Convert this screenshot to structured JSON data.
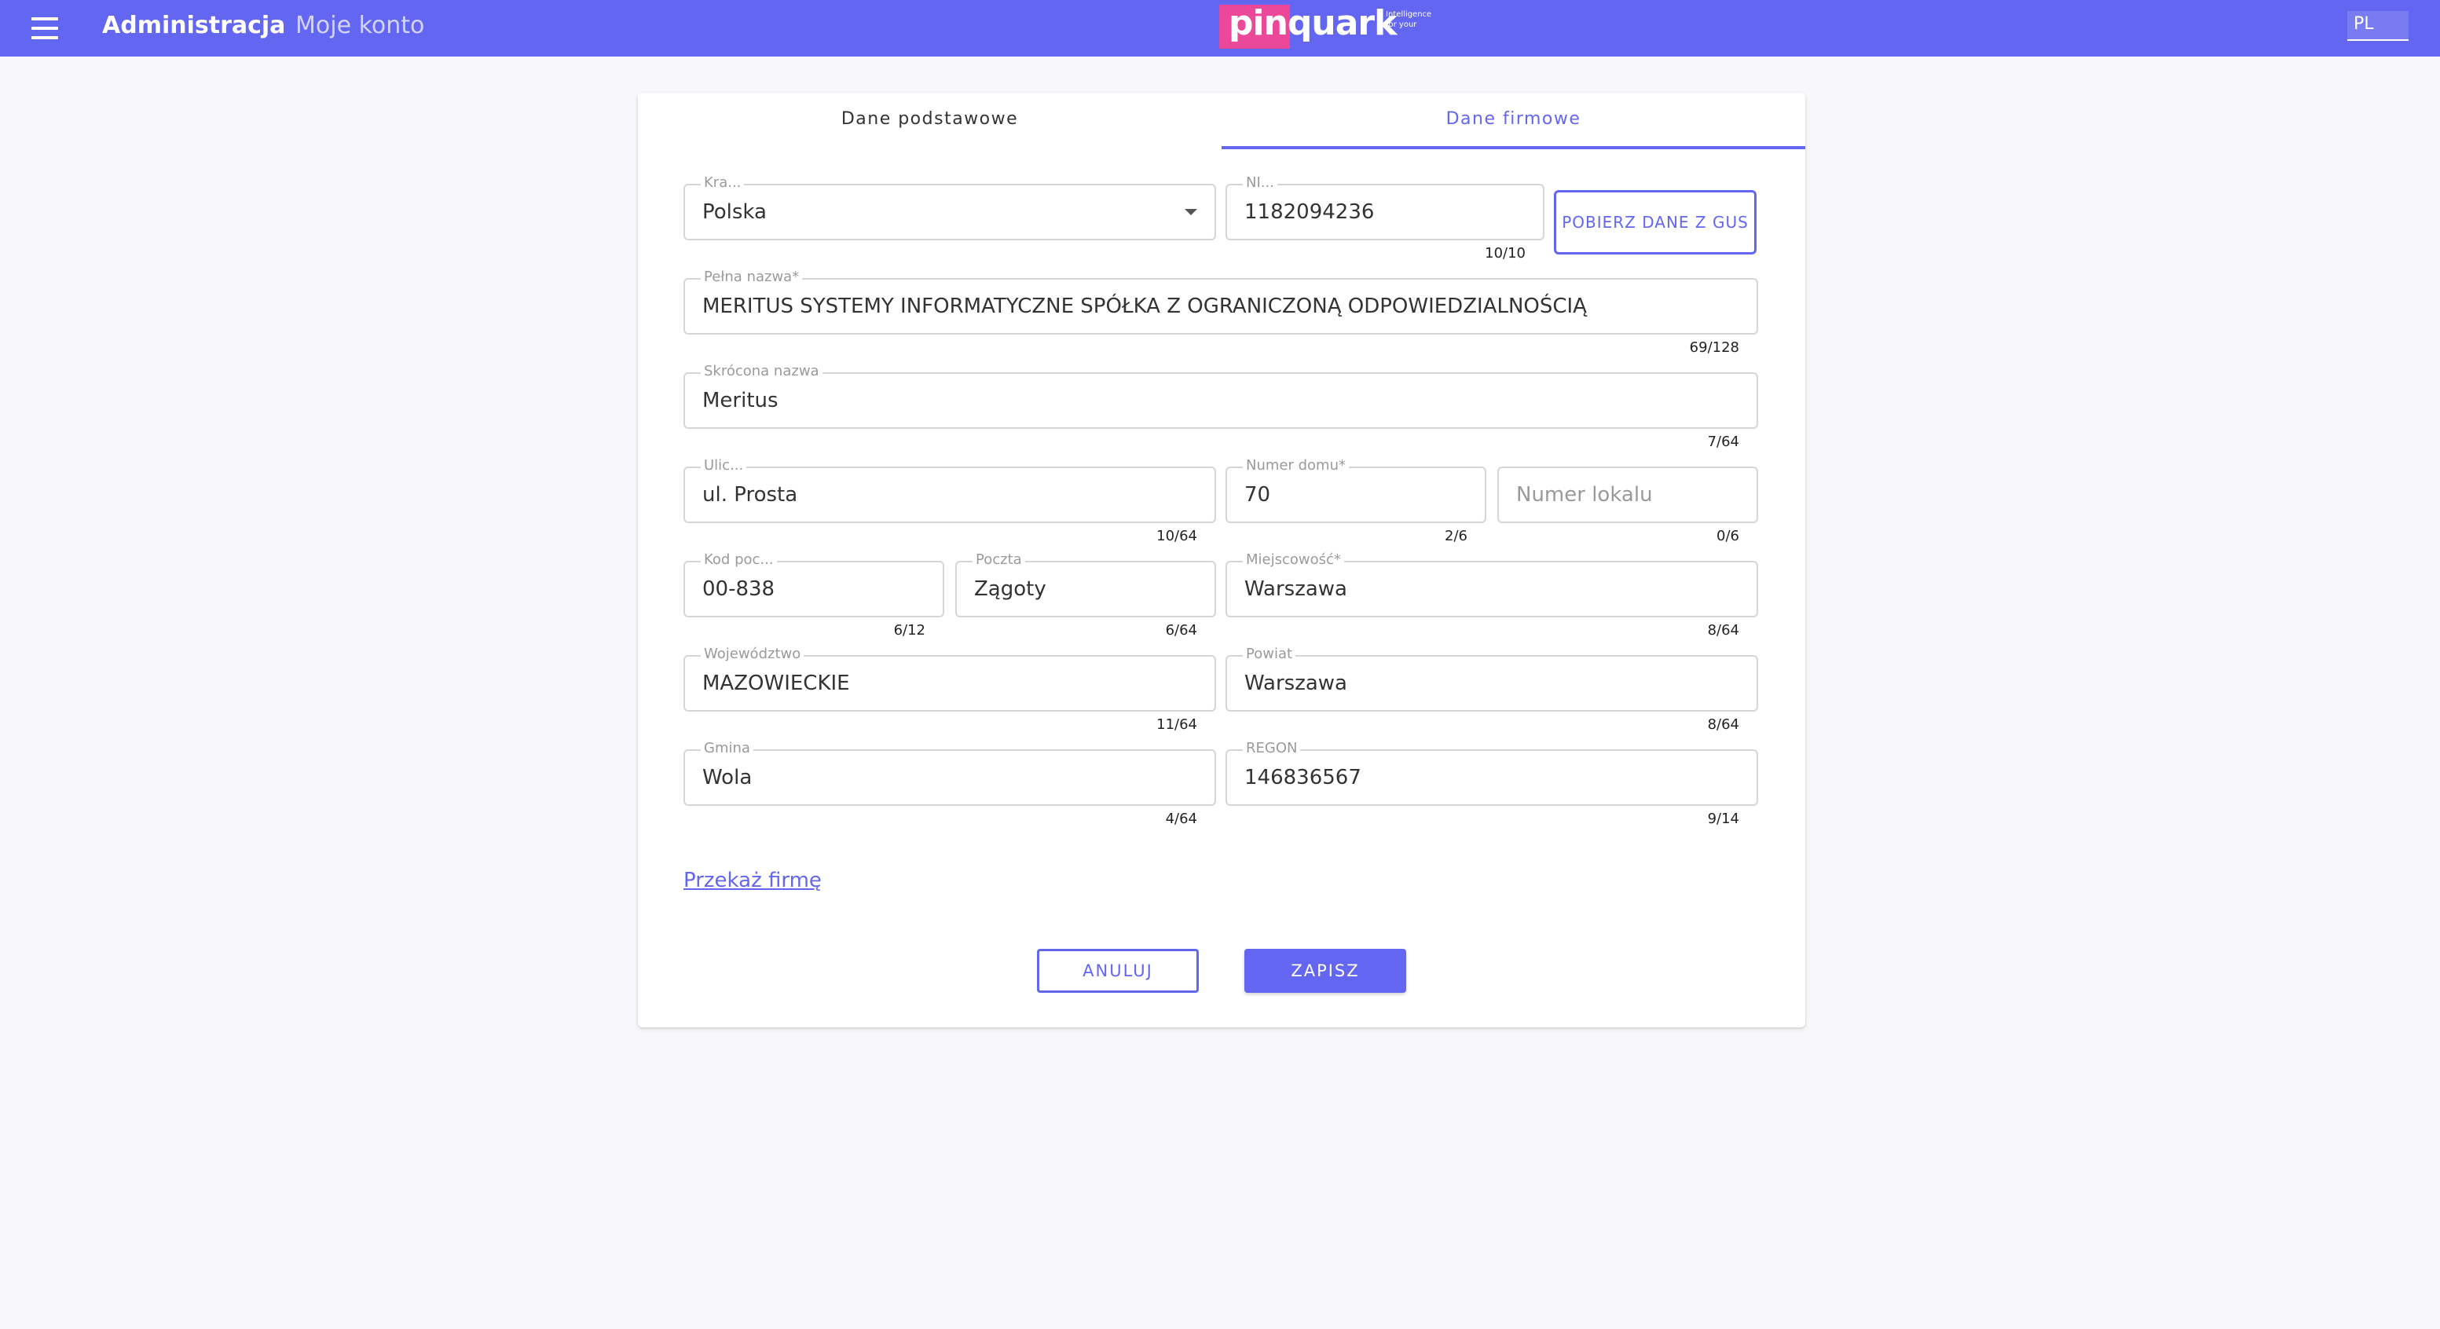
{
  "header": {
    "nav_admin": "Administracja",
    "nav_account": "Moje konto",
    "logo_text": "pinquark",
    "logo_tagline": [
      "Intelligence",
      "for your"
    ],
    "language": "PL",
    "accent_color": "#6366f1"
  },
  "tabs": {
    "basic": "Dane podstawowe",
    "company": "Dane firmowe",
    "active": "company"
  },
  "form": {
    "country": {
      "label": "Kra...",
      "value": "Polska"
    },
    "nip": {
      "label": "NI...",
      "value": "1182094236",
      "counter": "10/10"
    },
    "gus_button": "POBIERZ DANE Z GUS",
    "full_name": {
      "label": "Pełna nazwa*",
      "value": "MERITUS SYSTEMY INFORMATYCZNE SPÓŁKA Z OGRANICZONĄ ODPOWIEDZIALNOŚCIĄ",
      "counter": "69/128"
    },
    "short_name": {
      "label": "Skrócona nazwa",
      "value": "Meritus",
      "counter": "7/64"
    },
    "street": {
      "label": "Ulic...",
      "value": "ul. Prosta",
      "counter": "10/64"
    },
    "house_number": {
      "label": "Numer domu*",
      "value": "70",
      "counter": "2/6"
    },
    "apartment_number": {
      "placeholder": "Numer lokalu",
      "counter": "0/6"
    },
    "postal_code": {
      "label": "Kod poc...",
      "value": "00-838",
      "counter": "6/12"
    },
    "post_office": {
      "label": "Poczta",
      "value": "Zągoty",
      "counter": "6/64"
    },
    "city": {
      "label": "Miejscowość*",
      "value": "Warszawa",
      "counter": "8/64"
    },
    "voivodeship": {
      "label": "Województwo",
      "value": "MAZOWIECKIE",
      "counter": "11/64"
    },
    "district": {
      "label": "Powiat",
      "value": "Warszawa",
      "counter": "8/64"
    },
    "commune": {
      "label": "Gmina",
      "value": "Wola",
      "counter": "4/64"
    },
    "regon": {
      "label": "REGON",
      "value": "146836567",
      "counter": "9/14"
    }
  },
  "actions": {
    "transfer_link": "Przekaż firmę",
    "cancel": "ANULUJ",
    "save": "ZAPISZ"
  }
}
